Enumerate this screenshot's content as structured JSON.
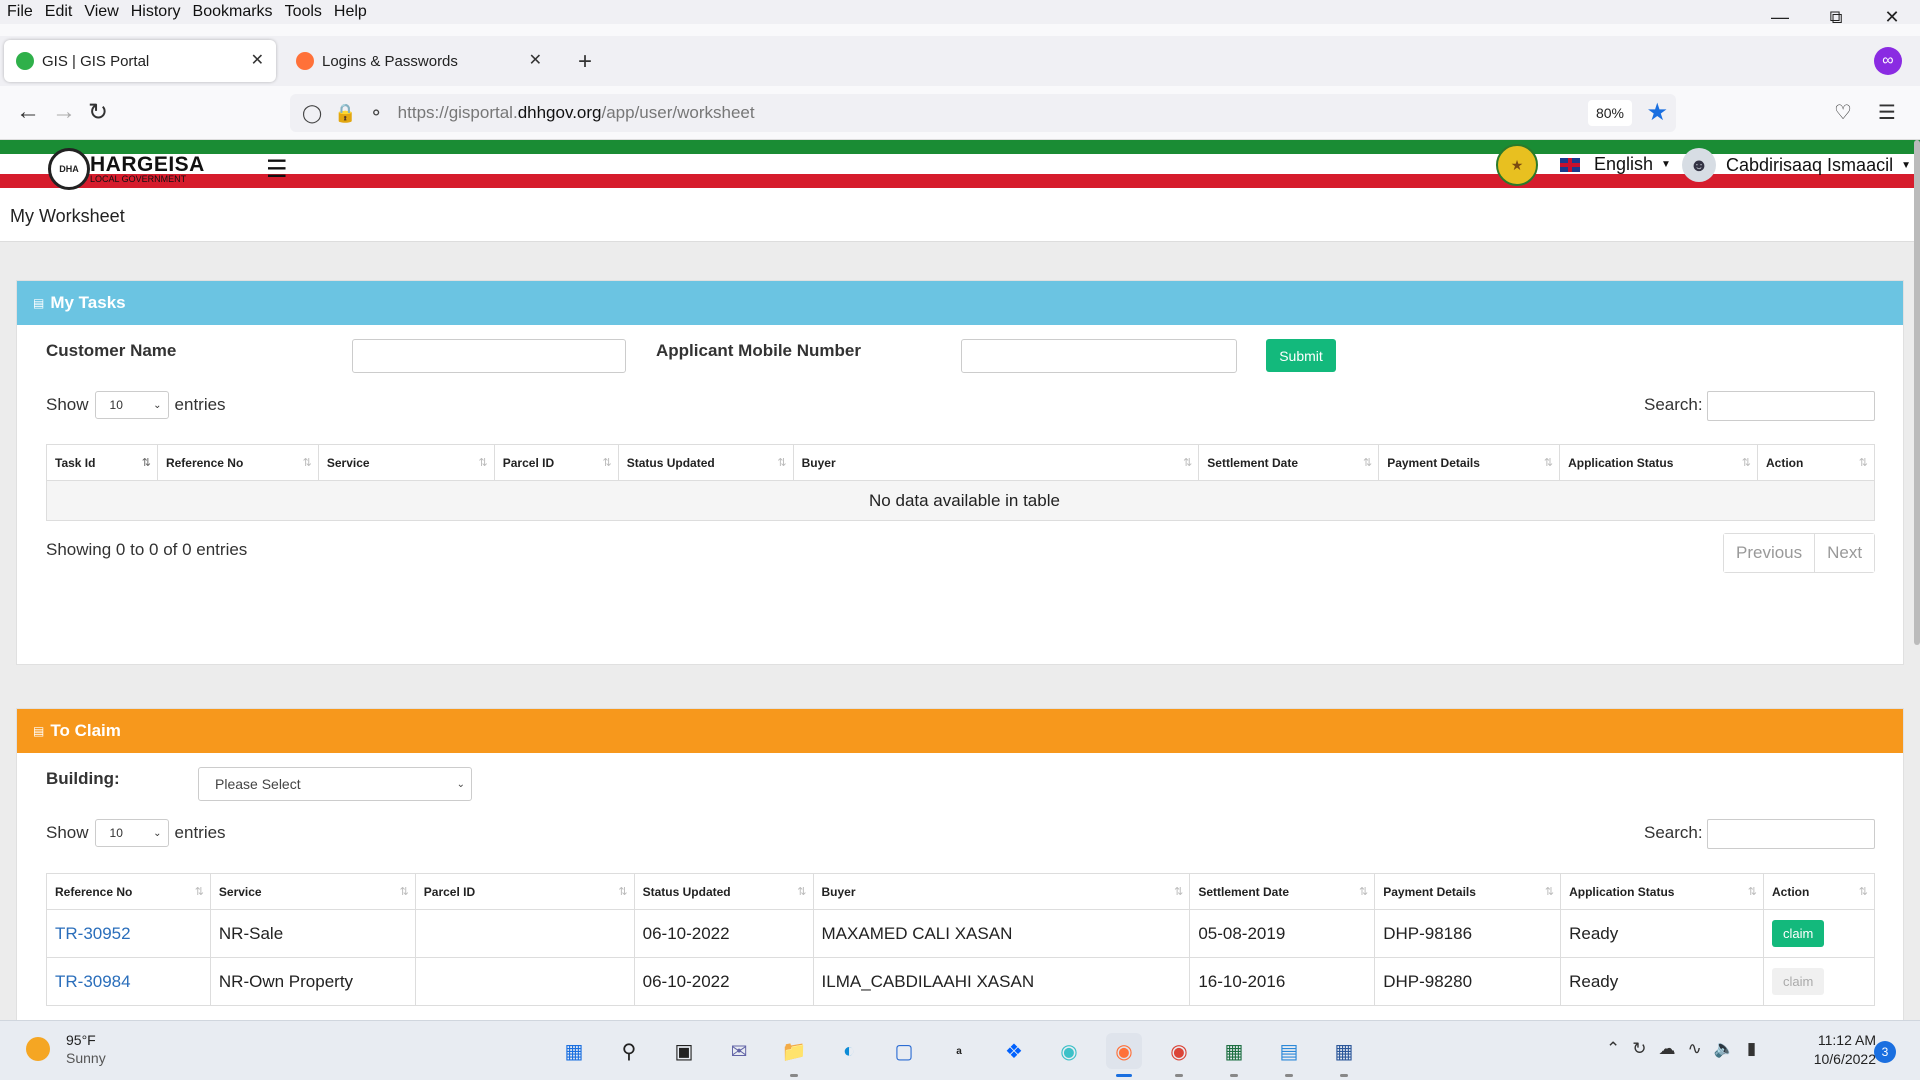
{
  "menubar": {
    "items": [
      "File",
      "Edit",
      "View",
      "History",
      "Bookmarks",
      "Tools",
      "Help"
    ]
  },
  "tabs": [
    {
      "title": "GIS | GIS Portal",
      "active": true
    },
    {
      "title": "Logins & Passwords",
      "active": false
    }
  ],
  "address": {
    "prefix": "https://gisportal.",
    "domain": "dhhgov.org",
    "path": "/app/user/worksheet",
    "zoom": "80%"
  },
  "site": {
    "logo_title": "HARGEISA",
    "logo_sub": "LOCAL GOVERNMENT",
    "logo_emblem": "DHA",
    "language": "English",
    "user_name": "Cabdirisaaq Ismaacil",
    "page_title": "My Worksheet"
  },
  "my_tasks": {
    "header": "My Tasks",
    "customer_name_label": "Customer Name",
    "mobile_label": "Applicant Mobile Number",
    "submit_label": "Submit",
    "show_label": "Show",
    "entries_label": "entries",
    "page_size": "10",
    "search_label": "Search:",
    "columns": [
      "Task Id",
      "Reference No",
      "Service",
      "Parcel ID",
      "Status Updated",
      "Buyer",
      "Settlement Date",
      "Payment Details",
      "Application Status",
      "Action"
    ],
    "empty_text": "No data available in table",
    "info": "Showing 0 to 0 of 0 entries",
    "prev_label": "Previous",
    "next_label": "Next"
  },
  "to_claim": {
    "header": "To Claim",
    "building_label": "Building:",
    "building_value": "Please Select",
    "show_label": "Show",
    "entries_label": "entries",
    "page_size": "10",
    "search_label": "Search:",
    "columns": [
      "Reference No",
      "Service",
      "Parcel ID",
      "Status Updated",
      "Buyer",
      "Settlement Date",
      "Payment Details",
      "Application Status",
      "Action"
    ],
    "rows": [
      {
        "ref": "TR-30952",
        "service": "NR-Sale",
        "parcel": "",
        "status_updated": "06-10-2022",
        "buyer": "MAXAMED CALI XASAN",
        "settlement": "05-08-2019",
        "payment": "DHP-98186",
        "app_status": "Ready",
        "action": "claim"
      },
      {
        "ref": "TR-30984",
        "service": "NR-Own Property",
        "parcel": "",
        "status_updated": "06-10-2022",
        "buyer": "ILMA_CABDILAAHI XASAN",
        "settlement": "16-10-2016",
        "payment": "DHP-98280",
        "app_status": "Ready",
        "action": "claim"
      }
    ]
  },
  "taskbar": {
    "temperature": "95°F",
    "weather": "Sunny",
    "time": "11:12 AM",
    "date": "10/6/2022",
    "notifications": "3"
  },
  "colors": {
    "tasks_header": "#6bc4e2",
    "claim_header": "#f7981c",
    "submit": "#13b97c",
    "link": "#2a6ebb"
  }
}
